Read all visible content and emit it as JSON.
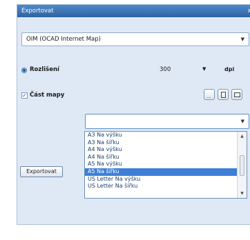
{
  "window": {
    "title": "Exportovat",
    "close_icon": "x"
  },
  "format_select": {
    "value": "OIM (OCAD Internet Map)"
  },
  "resolution": {
    "label": "Rozlišení",
    "value": "300",
    "unit": "dpi"
  },
  "map_part": {
    "label": "Část mapy",
    "checked": true
  },
  "page_select": {
    "value": ""
  },
  "export_button": {
    "label": "Exportovat"
  },
  "page_options": [
    "A3 Na výšku",
    "A3 Na šířku",
    "A4 Na výšku",
    "A4 Na šířku",
    "A5 Na výšku",
    "A5 Na šířku",
    "US Letter Na výšku",
    "US Letter Na šířku"
  ],
  "selected_option_index": 5,
  "colors": {
    "accent": "#3d7fd6",
    "panel": "#dfe9f5",
    "titlebar": "#3a74b6"
  }
}
